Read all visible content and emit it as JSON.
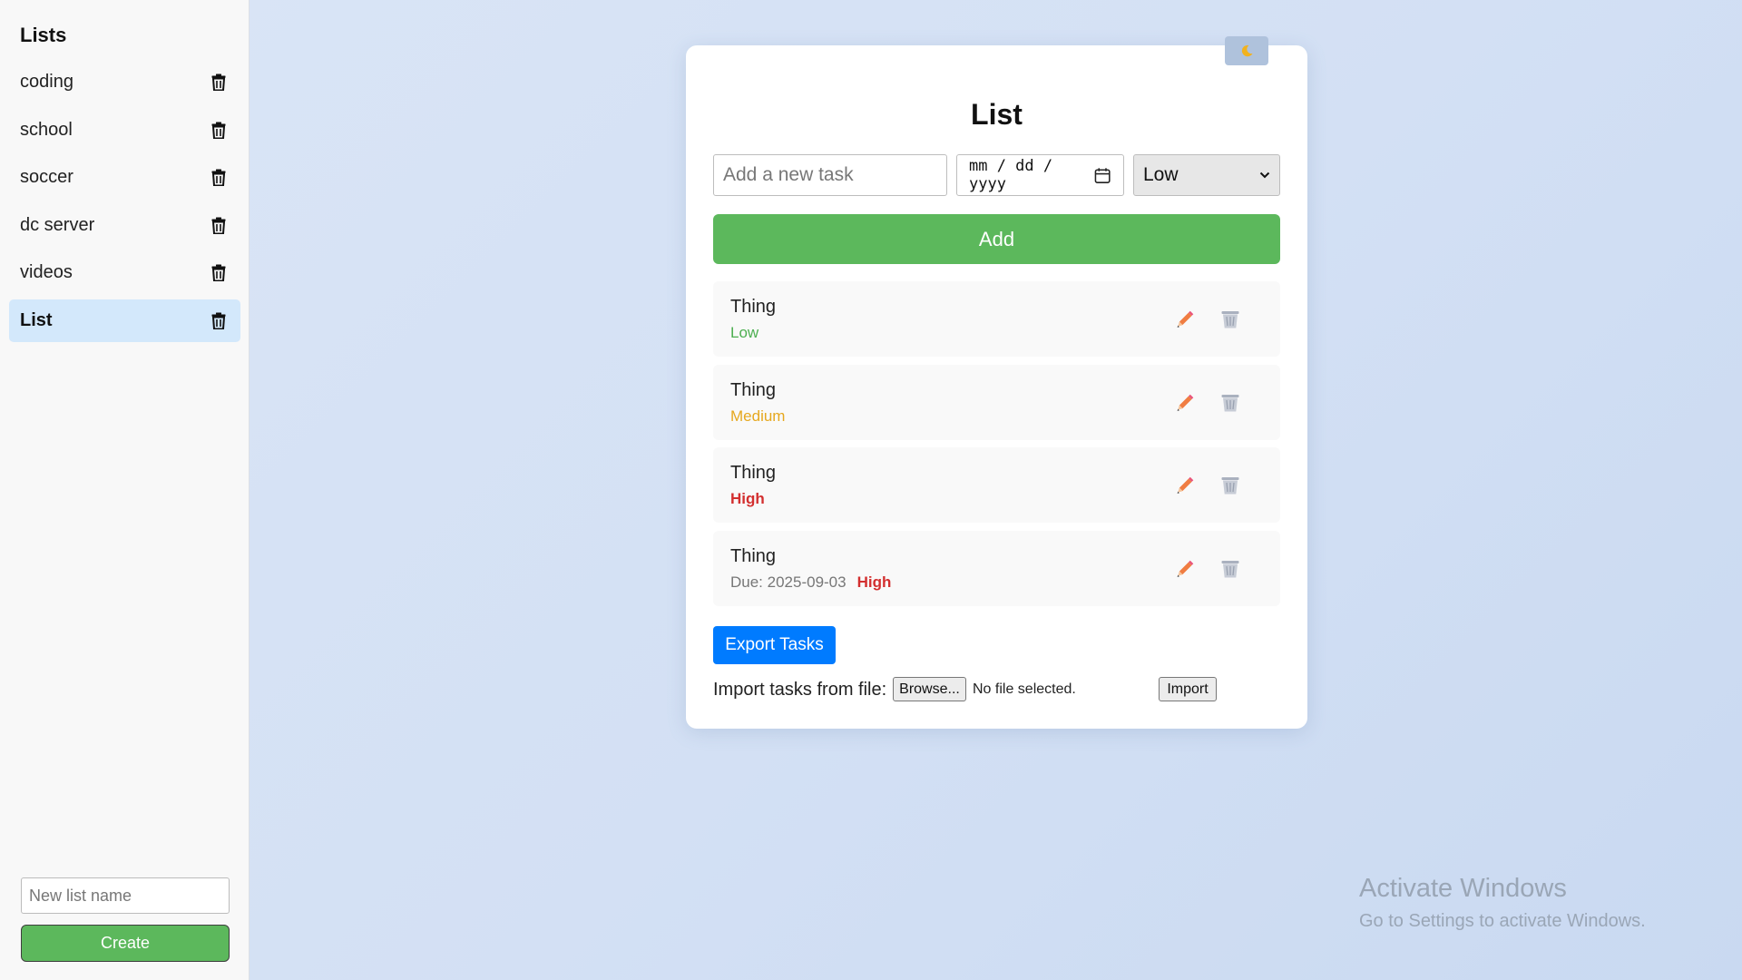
{
  "sidebar": {
    "title": "Lists",
    "items": [
      {
        "label": "coding"
      },
      {
        "label": "school"
      },
      {
        "label": "soccer"
      },
      {
        "label": "dc server"
      },
      {
        "label": "videos"
      },
      {
        "label": "List"
      }
    ],
    "active_index": 5,
    "new_list_placeholder": "New list name",
    "create_label": "Create"
  },
  "main": {
    "title": "List",
    "task_placeholder": "Add a new task",
    "date_placeholder": "mm / dd / yyyy",
    "priority_selected": "Low",
    "add_label": "Add",
    "tasks": [
      {
        "name": "Thing",
        "due": "",
        "priority": "Low"
      },
      {
        "name": "Thing",
        "due": "",
        "priority": "Medium"
      },
      {
        "name": "Thing",
        "due": "",
        "priority": "High"
      },
      {
        "name": "Thing",
        "due": "Due: 2025-09-03",
        "priority": "High"
      }
    ],
    "export_label": "Export Tasks",
    "import_label": "Import tasks from file:",
    "browse_label": "Browse...",
    "file_status": "No file selected.",
    "import_button": "Import"
  },
  "watermark": {
    "title": "Activate Windows",
    "subtitle": "Go to Settings to activate Windows."
  },
  "icons": {
    "theme_toggle": "moon-icon",
    "list_delete": "trash-icon",
    "task_edit": "pencil-icon",
    "task_delete": "wastebasket-icon",
    "date": "calendar-icon",
    "select": "chevron-down-icon"
  },
  "colors": {
    "green": "#5cb85c",
    "blue": "#007bff",
    "active_list": "#d3e8fb",
    "priority_low": "#4caf50",
    "priority_medium": "#e6a81f",
    "priority_high": "#d32f2f"
  }
}
